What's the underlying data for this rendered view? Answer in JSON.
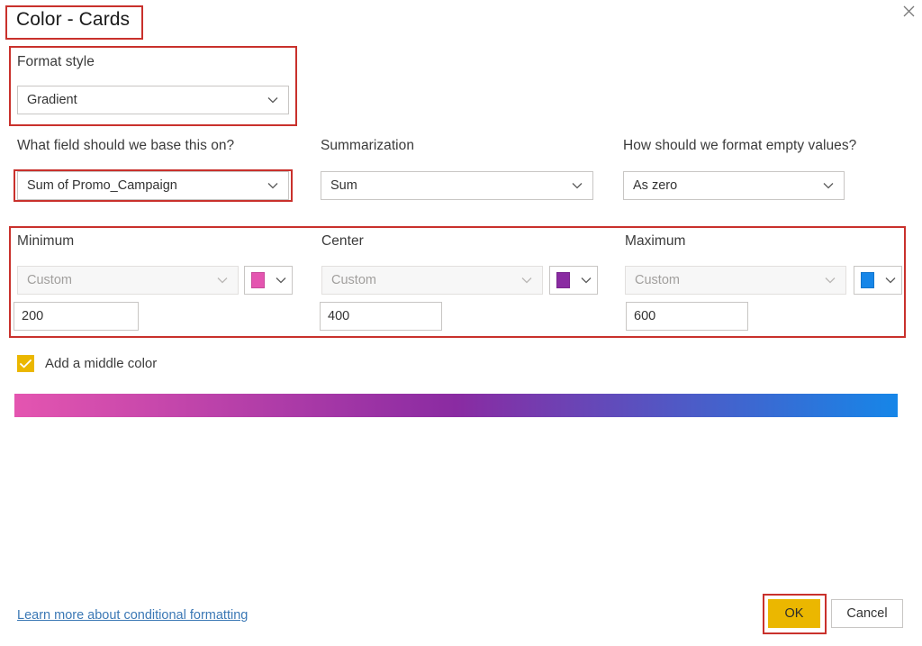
{
  "dialog": {
    "title": "Color - Cards",
    "close_icon": "close-icon"
  },
  "format_style": {
    "label": "Format style",
    "value": "Gradient",
    "chevron_icon": "chevron-down-icon"
  },
  "base_field": {
    "label": "What field should we base this on?",
    "value": "Sum of Promo_Campaign",
    "chevron_icon": "chevron-down-icon"
  },
  "summarization": {
    "label": "Summarization",
    "value": "Sum",
    "chevron_icon": "chevron-down-icon"
  },
  "empty_values": {
    "label": "How should we format empty values?",
    "value": "As zero",
    "chevron_icon": "chevron-down-icon"
  },
  "stops": [
    {
      "label": "Minimum",
      "mode": "Custom",
      "number": "200",
      "color": "#e455b0",
      "chevron_icon": "chevron-down-icon",
      "swatch_icon": "color-swatch-icon"
    },
    {
      "label": "Center",
      "mode": "Custom",
      "number": "400",
      "color": "#8a2ba2",
      "chevron_icon": "chevron-down-icon",
      "swatch_icon": "color-swatch-icon"
    },
    {
      "label": "Maximum",
      "mode": "Custom",
      "number": "600",
      "color": "#1686e8",
      "chevron_icon": "chevron-down-icon",
      "swatch_icon": "color-swatch-icon"
    }
  ],
  "middle_color": {
    "label": "Add a middle color",
    "checked": true,
    "check_icon": "check-icon",
    "checkbox_color": "#ebb700"
  },
  "gradient_preview": {
    "from": "#e455b0",
    "via": "#8a2ba2",
    "to": "#1686e8"
  },
  "footer": {
    "learn_more": "Learn more about conditional formatting",
    "ok": "OK",
    "cancel": "Cancel"
  },
  "annotations": {
    "accent": "#c9312c"
  }
}
